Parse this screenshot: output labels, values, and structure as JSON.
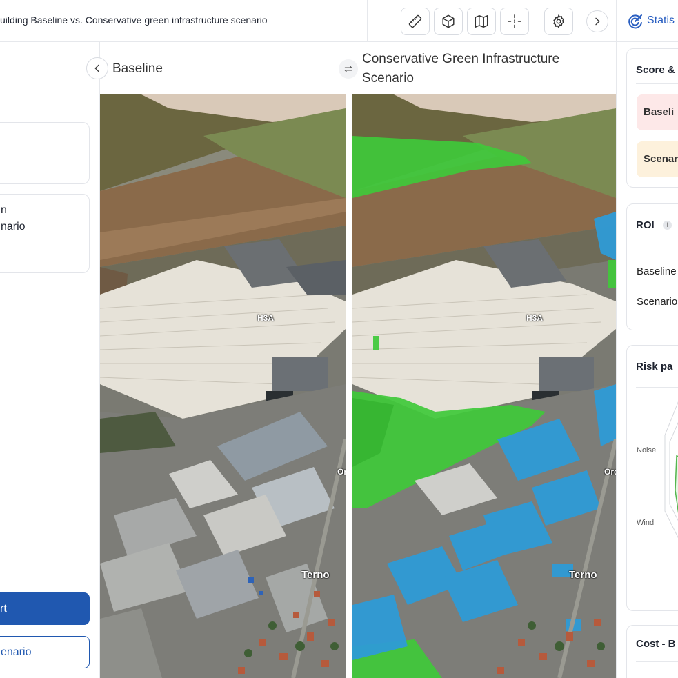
{
  "header": {
    "title": "uilding Baseline vs. Conservative green infrastructure scenario",
    "tools": [
      "ruler-icon",
      "cube-icon",
      "map-icon",
      "crosshair-icon",
      "settings-icon",
      "chevron-right-icon"
    ]
  },
  "left_panel": {
    "card1_lines": [],
    "card2_lines": [
      "n",
      "nario"
    ],
    "primary_button": "rt",
    "secondary_button": "enario"
  },
  "columns": {
    "left_title": "Baseline",
    "right_title_line1": "Conservative Green Infrastructure",
    "right_title_line2": "Scenario"
  },
  "map_labels": {
    "building": "H3A",
    "place": "Terno",
    "road_left": "Or",
    "road_right": "Ord"
  },
  "right_panel": {
    "tab_label": "Statis",
    "score_card": {
      "title": "Score &",
      "baseline_pill": "Baseli",
      "scenario_pill": "Scenar"
    },
    "roi_card": {
      "title": "ROI",
      "info": "i",
      "baseline": "Baseline",
      "scenario": "Scenario"
    },
    "risk_card": {
      "title": "Risk pa",
      "axis_noise": "Noise",
      "axis_wind": "Wind"
    },
    "cost_card": {
      "title": "Cost - B"
    }
  },
  "colors": {
    "accent": "#2058b0",
    "link": "#2a5fc1",
    "baseline_pill": "#fde8e8",
    "scenario_pill": "#fdf1dc",
    "green_overlay": "#3fc93a",
    "blue_overlay": "#2e9bd6"
  }
}
